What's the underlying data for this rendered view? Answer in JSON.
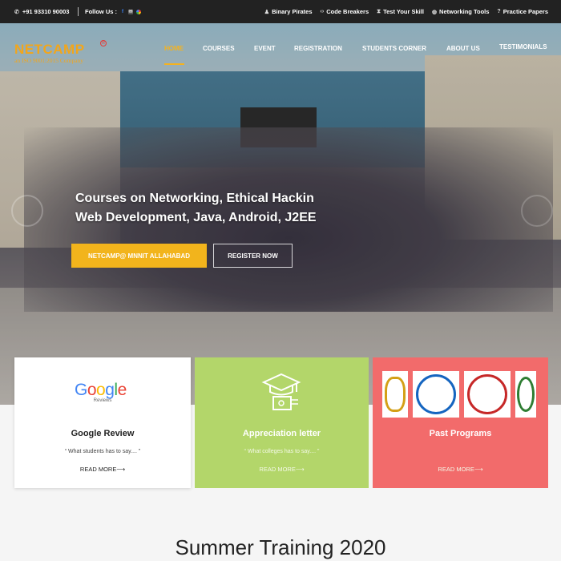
{
  "topbar": {
    "phone": "+91 93310 90003",
    "follow_label": "Follow Us :",
    "links": [
      {
        "label": "Binary Pirates",
        "icon": "user-group-icon"
      },
      {
        "label": "Code Breakers",
        "icon": "code-icon"
      },
      {
        "label": "Test Your Skill",
        "icon": "hourglass-icon"
      },
      {
        "label": "Networking Tools",
        "icon": "globe-icon"
      },
      {
        "label": "Practice Papers",
        "icon": "question-icon"
      }
    ]
  },
  "logo": {
    "name": "NETCAMP",
    "registered": "R",
    "tagline": "an ISO 9001:2015 Company"
  },
  "nav": {
    "items": [
      "HOME",
      "COURSES",
      "EVENT",
      "REGISTRATION",
      "STUDENTS CORNER",
      "ABOUT US",
      "TESTIMONIALS"
    ],
    "active": "HOME"
  },
  "hero": {
    "line1": "Courses on Networking, Ethical Hackin",
    "line2": "Web Development, Java, Android, J2EE",
    "primary_button": "NETCAMP@ MNNIT ALLAHABAD",
    "secondary_button": "REGISTER NOW"
  },
  "cards": [
    {
      "title": "Google Review",
      "subtitle": "“ What students has to say.... ”",
      "more": "READ MORE⟶",
      "logo_text": "Google",
      "logo_sub": "Reviews"
    },
    {
      "title": "Appreciation letter",
      "subtitle": "“ What colleges has to say.... ”",
      "more": "READ MORE⟶"
    },
    {
      "title": "Past Programs",
      "more": "READ MORE⟶"
    }
  ],
  "section": {
    "title": "Summer Training 2020"
  },
  "colors": {
    "accent": "#f2b41c",
    "card_green": "#b3d66a",
    "card_red": "#f26b6b",
    "topbar": "#222222"
  }
}
